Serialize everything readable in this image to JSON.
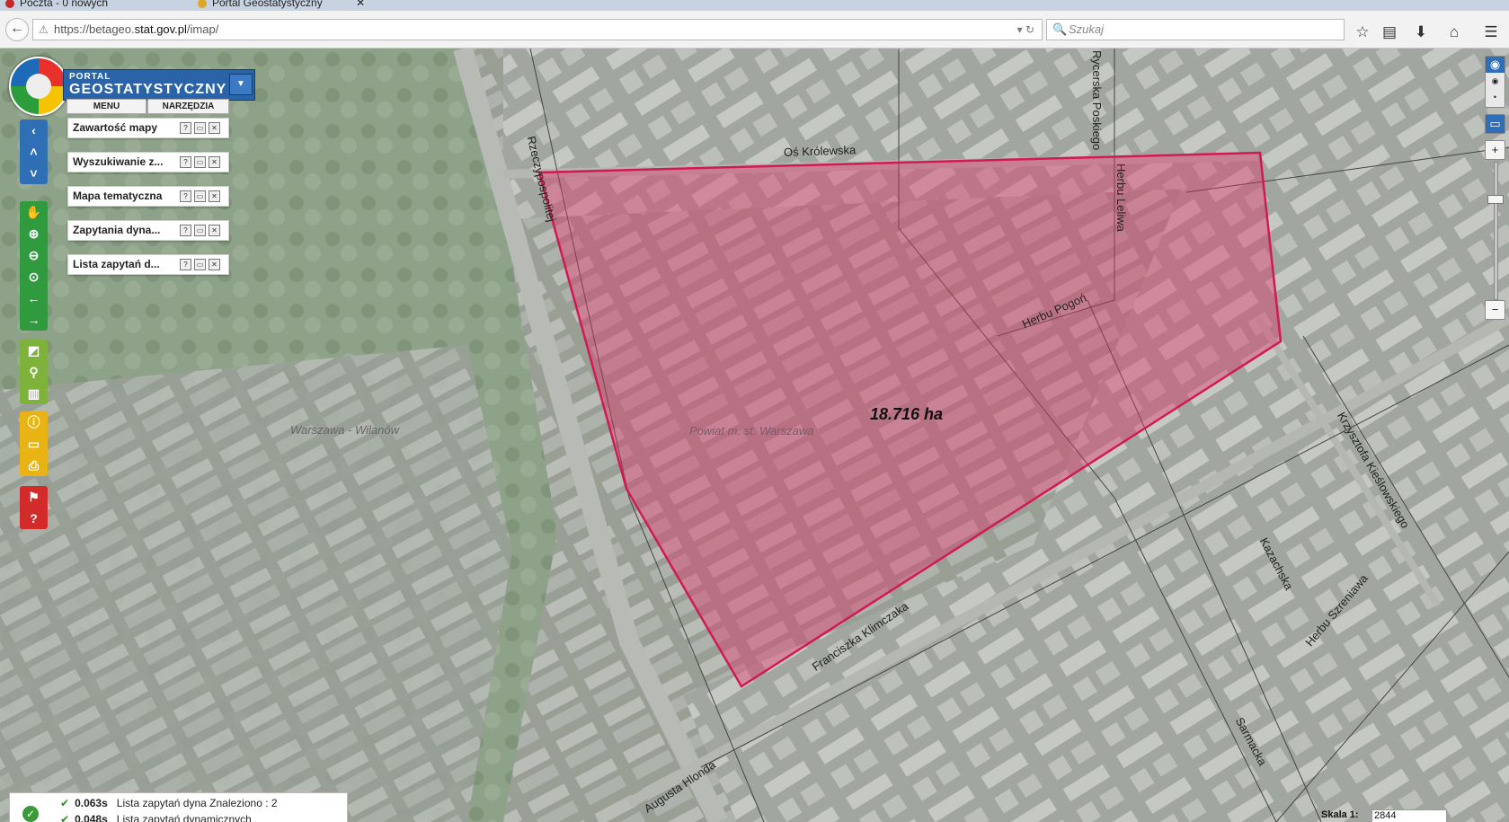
{
  "browser": {
    "tabs": [
      {
        "label": "Poczta - 0 nowych",
        "icon_color": "#c22a2a"
      },
      {
        "label": "Portal Geostatystyczny",
        "icon_color": "#e0a528"
      }
    ],
    "url_prefix": "https://betageo.",
    "url_domain": "stat.gov.pl",
    "url_suffix": "/imap/",
    "search_placeholder": "Szukaj",
    "icons": [
      "back-icon",
      "warning-icon",
      "reload-icon",
      "search-icon",
      "bookmark-star-icon",
      "reading-list-icon",
      "download-icon",
      "home-icon",
      "menu-icon"
    ]
  },
  "portal": {
    "title_small": "PORTAL",
    "title_big": "GEOSTATYSTYCZNY",
    "menu_label": "MENU",
    "tools_label": "NARZĘDZIA"
  },
  "panels": [
    {
      "title": "Zawartość mapy"
    },
    {
      "title": "Wyszukiwanie z..."
    },
    {
      "title": "Mapa tematyczna"
    },
    {
      "title": "Zapytania dyna..."
    },
    {
      "title": "Lista zapytań d..."
    }
  ],
  "map": {
    "area_label": "18.716 ha",
    "region_label_1": "Powiat m. st. Warszawa",
    "region_label_2": "Warszawa - Wilanów",
    "streets": {
      "os_krolewska": "Oś Królewska",
      "rycerska": "Rycerska Poskiego",
      "herbu_lewiec": "Herbu Leliwa",
      "herbu_pogon": "Herbu Pogoń",
      "rzeczypospolitej": "Rzeczypospolitej",
      "klimczaka": "Franciszka Klimczaka",
      "hlonda": "Augusta Hlonda",
      "kieslowskiego": "Krzysztofa Kieślowskiego",
      "kazachska": "Kazachska",
      "szreniawa": "Herbu Szreniawa",
      "sarmacka": "Sarmacka"
    },
    "polygon_color": "#e0336a"
  },
  "status": {
    "row1_time": "0.063s",
    "row1_text": "Lista zapytań dyna  Znaleziono : 2",
    "row2_time": "0.048s",
    "row2_text": "Lista zapytań dynamicznych"
  },
  "scale": {
    "label": "Skala 1:",
    "value": "2844"
  }
}
